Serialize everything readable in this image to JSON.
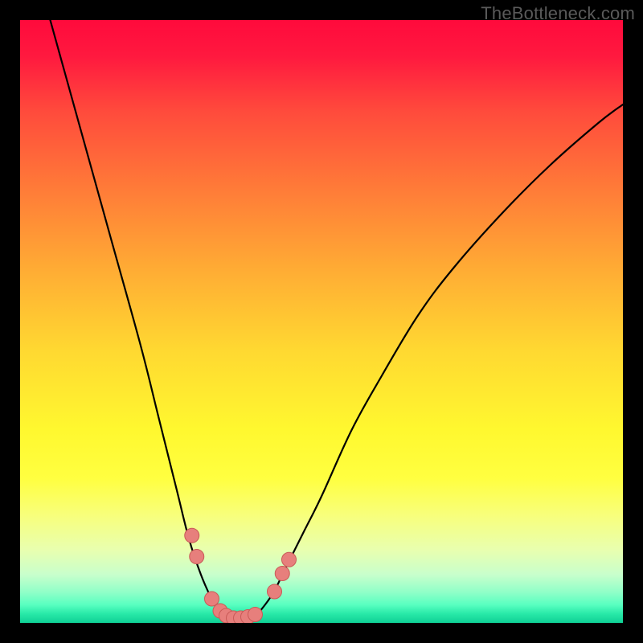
{
  "watermark": "TheBottleneck.com",
  "colors": {
    "frame": "#000000",
    "curve": "#000000",
    "markers_fill": "#e77f7c",
    "markers_stroke": "#c95a57"
  },
  "chart_data": {
    "type": "line",
    "title": "",
    "xlabel": "",
    "ylabel": "",
    "xlim": [
      0,
      100
    ],
    "ylim": [
      0,
      100
    ],
    "series": [
      {
        "name": "bottleneck-curve",
        "x": [
          5,
          10,
          15,
          20,
          23,
          26,
          28,
          30,
          32,
          33,
          34,
          35,
          36,
          37,
          38,
          39,
          40,
          42,
          44,
          47,
          50,
          55,
          60,
          66,
          72,
          80,
          88,
          96,
          100
        ],
        "y": [
          100,
          82,
          64,
          46,
          34,
          22,
          14,
          8,
          3.5,
          2,
          1.2,
          0.8,
          0.6,
          0.6,
          0.8,
          1.3,
          2.2,
          5,
          9,
          15,
          21,
          32,
          41,
          51,
          59,
          68,
          76,
          83,
          86
        ]
      }
    ],
    "markers": [
      {
        "x": 28.5,
        "y": 14.5
      },
      {
        "x": 29.3,
        "y": 11.0
      },
      {
        "x": 31.8,
        "y": 4.0
      },
      {
        "x": 33.2,
        "y": 2.0
      },
      {
        "x": 34.2,
        "y": 1.2
      },
      {
        "x": 35.4,
        "y": 0.8
      },
      {
        "x": 36.6,
        "y": 0.8
      },
      {
        "x": 37.8,
        "y": 1.0
      },
      {
        "x": 39.0,
        "y": 1.4
      },
      {
        "x": 42.2,
        "y": 5.2
      },
      {
        "x": 43.5,
        "y": 8.2
      },
      {
        "x": 44.6,
        "y": 10.5
      }
    ]
  }
}
